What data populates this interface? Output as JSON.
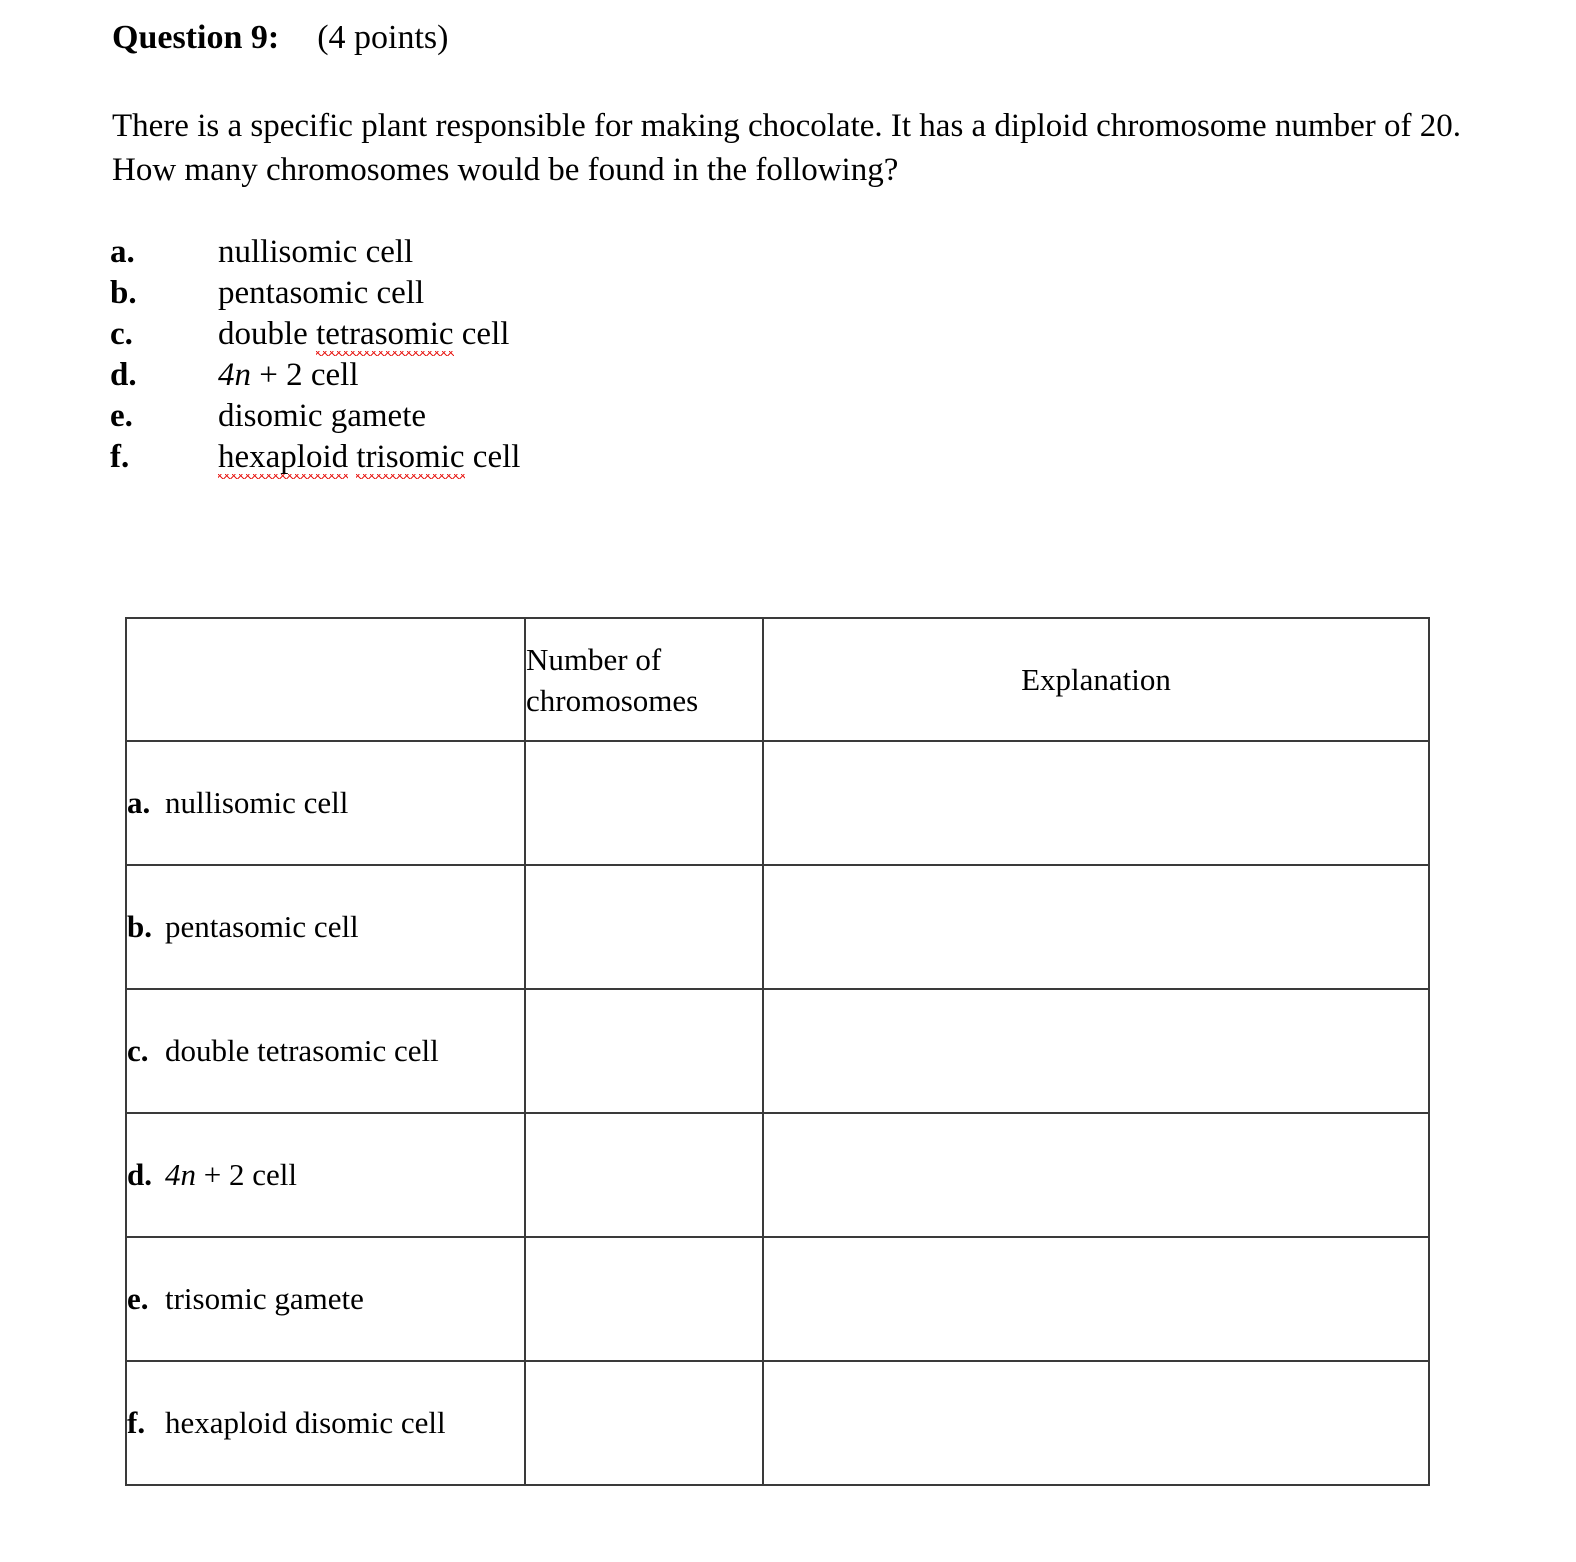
{
  "question": {
    "label": "Question 9:",
    "points": "(4 points)",
    "body": "There is a specific plant responsible for making chocolate. It has a diploid chromosome number of 20. How many chromosomes would be found in the following?"
  },
  "list": {
    "items": [
      {
        "marker": "a.",
        "text": "nullisomic cell",
        "misspelled": [],
        "italic_prefix": ""
      },
      {
        "marker": "b.",
        "text": "pentasomic cell",
        "misspelled": [],
        "italic_prefix": ""
      },
      {
        "marker": "c.",
        "text": "double tetrasomic cell",
        "misspelled": [
          "tetrasomic"
        ],
        "italic_prefix": ""
      },
      {
        "marker": "d.",
        "text": "4n + 2 cell",
        "misspelled": [],
        "italic_prefix": "4n"
      },
      {
        "marker": "e.",
        "text": "disomic gamete",
        "misspelled": [],
        "italic_prefix": ""
      },
      {
        "marker": "f.",
        "text": "hexaploid trisomic cell",
        "misspelled": [
          "hexaploid",
          "trisomic"
        ],
        "italic_prefix": ""
      }
    ],
    "c_pre": "double ",
    "c_mis": "tetrasomic",
    "c_post": " cell",
    "d_ital": "4n",
    "d_rest": " + 2 cell",
    "f_mis1": "hexaploid",
    "f_gap": " ",
    "f_mis2": "trisomic",
    "f_post": " cell"
  },
  "table": {
    "headers": {
      "blank": "",
      "number_line1": "Number of",
      "number_line2": "chromosomes",
      "explanation": "Explanation"
    },
    "rows": [
      {
        "marker": "a.",
        "label": "nullisomic cell",
        "number": "",
        "explanation": ""
      },
      {
        "marker": "b.",
        "label": "pentasomic cell",
        "number": "",
        "explanation": ""
      },
      {
        "marker": "c.",
        "label": "double tetrasomic cell",
        "number": "",
        "explanation": ""
      },
      {
        "marker": "d.",
        "label": "4n + 2 cell",
        "number": "",
        "explanation": "",
        "italic_prefix": "4n",
        "rest": " + 2 cell"
      },
      {
        "marker": "e.",
        "label": "trisomic gamete",
        "number": "",
        "explanation": ""
      },
      {
        "marker": "f.",
        "label": "hexaploid disomic cell",
        "number": "",
        "explanation": ""
      }
    ]
  },
  "colors": {
    "text": "#000000",
    "border": "#3a3a3a",
    "spellcheck": "#e8201c",
    "background": "#ffffff"
  }
}
